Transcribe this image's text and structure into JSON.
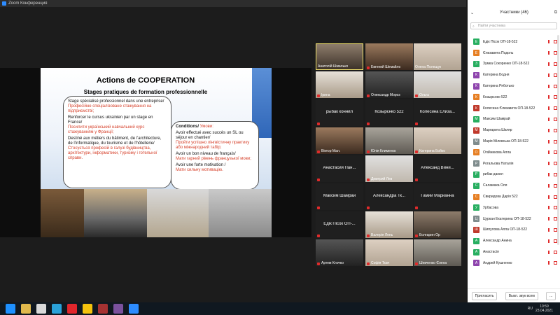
{
  "window": {
    "title": "Zoom Конференция"
  },
  "slide": {
    "title": "Actions de COOPERATION",
    "subtitle": "Stages pratiques de formation professionnelle",
    "left_box": [
      {
        "fr": "Stage spécialisé professionnel dans une entreprise/",
        "ua": "Професійне спеціалізоване стажування на підприємстві;"
      },
      {
        "fr": "Renforcer le cursus ukrainien par un stage en France/",
        "ua": "Посилити український навчальний курс стажуванням у Франції;"
      },
      {
        "fr": "Destiné aux métiers du bâtiment, de l'architecture, de l'informatique, du tourisme et de l'hôtellerie/",
        "ua": "Стосується професій в галузі будівництва, архітектури, інформатики, туризму і готельної справи."
      }
    ],
    "right_box": {
      "heading_fr": "Conditions/",
      "heading_ua": " Умови:",
      "items": [
        {
          "fr": "Avoir effectué avec succès un SL ou séjour en chantier/",
          "ua": "Пройти успішно лінгвістичну практику або міжнародний табір;"
        },
        {
          "fr": "Avoir un bon niveau de français/",
          "ua": "Мати гарний рівень французької мови;"
        },
        {
          "fr": "Avoir une forte motivation /",
          "ua": "Мати сильну мотивацію."
        }
      ]
    }
  },
  "gallery": [
    {
      "name": "Анатолій Шмалько",
      "cam": "cam1",
      "active": true,
      "mic": false
    },
    {
      "name": "Евгений Шемайло",
      "cam": "cam6",
      "mic": true
    },
    {
      "name": "Олена Полещук",
      "cam": "cam3",
      "mic": false
    },
    {
      "name": "Ірина",
      "cam": "cam4",
      "mic": true
    },
    {
      "name": "Олександр Мороз",
      "cam": "cam7",
      "mic": true
    },
    {
      "name": "Ольга",
      "cam": "cam5",
      "mic": true
    },
    {
      "name": "рыбак коннил",
      "nocam": true
    },
    {
      "name": "Козырєнко 522",
      "nocam": true
    },
    {
      "name": "Колесина Елиза...",
      "nocam": true
    },
    {
      "name": "Віктор Мал.",
      "cam": "cam6",
      "mic": true
    },
    {
      "name": "Юлія Клименко",
      "cam": "cam2",
      "mic": true
    },
    {
      "name": "Катерина Бойко",
      "cam": "cam3",
      "mic": true
    },
    {
      "name": "Анастасия Пан...",
      "nocam": true
    },
    {
      "name": "Дмитрий Лев",
      "cam": "cam5",
      "mic": true
    },
    {
      "name": "Александ Вини...",
      "nocam": true
    },
    {
      "name": "Максим Шамрай",
      "nocam": true
    },
    {
      "name": "Александра Тк...",
      "nocam": true
    },
    {
      "name": "Гамий Марианна",
      "nocam": true
    },
    {
      "name": "Едік Пісок ОП-...",
      "nocam": true
    },
    {
      "name": "Валерія Лень",
      "cam": "cam4",
      "mic": true
    },
    {
      "name": "Болгарин Ор",
      "cam": "cam1",
      "mic": true
    },
    {
      "name": "Артем Клочко",
      "cam": "cam7",
      "mic": true
    },
    {
      "name": "Софія Ткач",
      "cam": "cam3",
      "mic": true
    },
    {
      "name": "Шевченко Єлена",
      "cam": "cam2",
      "mic": true
    }
  ],
  "panel": {
    "title": "Участники (46)",
    "search_placeholder": "Найти участника",
    "participants": [
      {
        "initial": "Е",
        "name": "Едік Пісок ОП-18-522",
        "color": "#27ae60"
      },
      {
        "initial": "Е",
        "name": "Єлизавета Подоль",
        "color": "#e67e22"
      },
      {
        "initial": "З",
        "name": "Зумка Сокоренко ОП-18-522",
        "color": "#27ae60"
      },
      {
        "initial": "К",
        "name": "Катерина Бодня",
        "color": "#8e44ad"
      },
      {
        "initial": "К",
        "name": "Катерина Ряботько",
        "color": "#8e44ad"
      },
      {
        "initial": "К",
        "name": "Козырєнко 522",
        "color": "#e67e22"
      },
      {
        "initial": "К",
        "name": "Колесина Єлизавета ОП-18-522",
        "color": "#c0392b"
      },
      {
        "initial": "М",
        "name": "Максим Шамрай",
        "color": "#27ae60"
      },
      {
        "initial": "М",
        "name": "Маргарита Шкляр",
        "color": "#c0392b"
      },
      {
        "initial": "М",
        "name": "Марія Мілевська ОП-18-522",
        "color": "#7f8c8d"
      },
      {
        "initial": "О",
        "name": "Олійникова Алла",
        "color": "#e67e22"
      },
      {
        "initial": "Р",
        "name": "Рогальова Наталія",
        "color": "#7f8c8d"
      },
      {
        "initial": "Р",
        "name": "рибак данил",
        "color": "#27ae60"
      },
      {
        "initial": "С",
        "name": "Саламаха Оля",
        "color": "#27ae60"
      },
      {
        "initial": "С",
        "name": "Свиридова Дарія 522",
        "color": "#e67e22"
      },
      {
        "initial": "У",
        "name": "Урбасова",
        "color": "#27ae60"
      },
      {
        "initial": "Ц",
        "name": "Цуркан Екатерина ОП-18-522",
        "color": "#7f8c8d"
      },
      {
        "initial": "Ш",
        "name": "Шипулова Алла ОП-18-522",
        "color": "#c0392b"
      },
      {
        "initial": "А",
        "name": "Александр Анина",
        "color": "#27ae60"
      },
      {
        "initial": "А",
        "name": "Анастасія",
        "color": "#27ae60"
      },
      {
        "initial": "А",
        "name": "Андрей Кушненко",
        "color": "#8e44ad"
      }
    ],
    "invite_label": "Пригласить",
    "mute_all_label": "Выкл. звук всем",
    "more_label": "..."
  },
  "taskbar": {
    "apps": [
      {
        "name": "start-button",
        "color": "#1e90ff"
      },
      {
        "name": "file-explorer",
        "color": "#e0b84c"
      },
      {
        "name": "media-player",
        "color": "#d9d9d9"
      },
      {
        "name": "telegram",
        "color": "#2aa1d8"
      },
      {
        "name": "opera",
        "color": "#e0262c"
      },
      {
        "name": "chrome",
        "color": "#f4c20d"
      },
      {
        "name": "pdf-reader",
        "color": "#a63232"
      },
      {
        "name": "viber",
        "color": "#7b519d"
      },
      {
        "name": "zoom",
        "color": "#2d8cff"
      }
    ],
    "lang": "RU",
    "time": "10:59",
    "date": "23.04.2021"
  }
}
